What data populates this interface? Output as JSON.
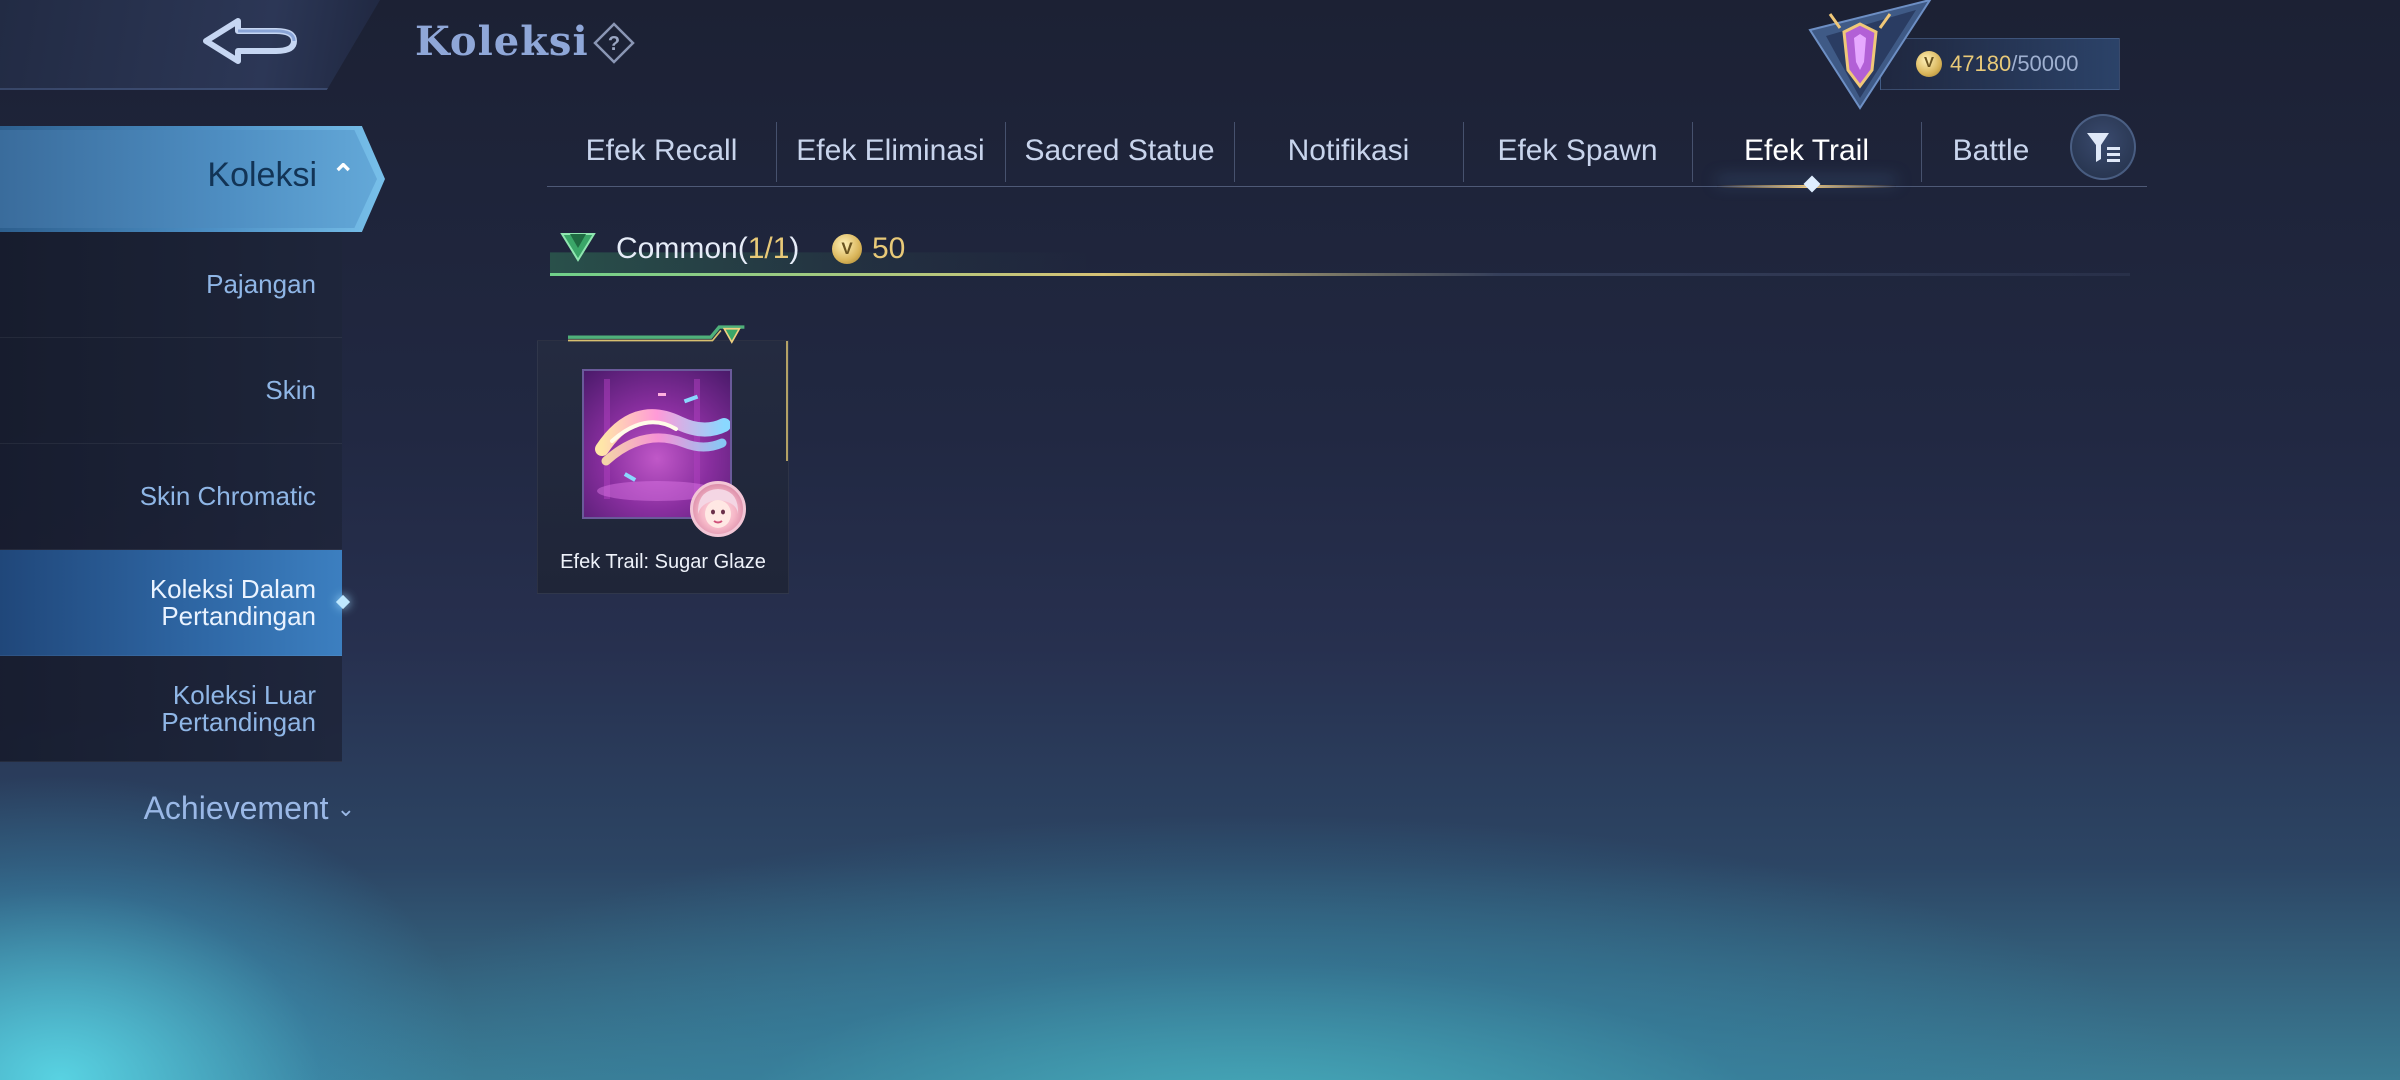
{
  "header": {
    "title": "Koleksi",
    "back_icon": "back-arrow-icon",
    "help_icon": "question-icon"
  },
  "currency": {
    "current": "47180",
    "separator": "/",
    "max": "50000",
    "icon": "collection-coin-icon"
  },
  "sidebar": {
    "main": {
      "label": "Koleksi",
      "chevron": "⌃"
    },
    "items": [
      {
        "label": "Pajangan"
      },
      {
        "label": "Skin"
      },
      {
        "label": "Skin Chromatic"
      },
      {
        "label": "Koleksi Dalam Pertandingan"
      },
      {
        "label": "Koleksi Luar Pertandingan"
      }
    ],
    "achievement": {
      "label": "Achievement",
      "chevron": "⌄"
    }
  },
  "tabs": [
    {
      "label": "Efek Recall"
    },
    {
      "label": "Efek Eliminasi"
    },
    {
      "label": "Sacred Statue"
    },
    {
      "label": "Notifikasi"
    },
    {
      "label": "Efek Spawn"
    },
    {
      "label": "Efek Trail"
    },
    {
      "label": "Battle"
    }
  ],
  "active_tab": "Efek Trail",
  "section": {
    "tier": "Common",
    "count_open": "(",
    "count": "1/1",
    "count_close": ")",
    "points": "50"
  },
  "items": [
    {
      "name": "Efek Trail: Sugar Glaze"
    }
  ],
  "colors": {
    "accent_gold": "#e8c978",
    "sidebar_active": "#3c7fc0",
    "text_light": "#c8d4ec"
  }
}
